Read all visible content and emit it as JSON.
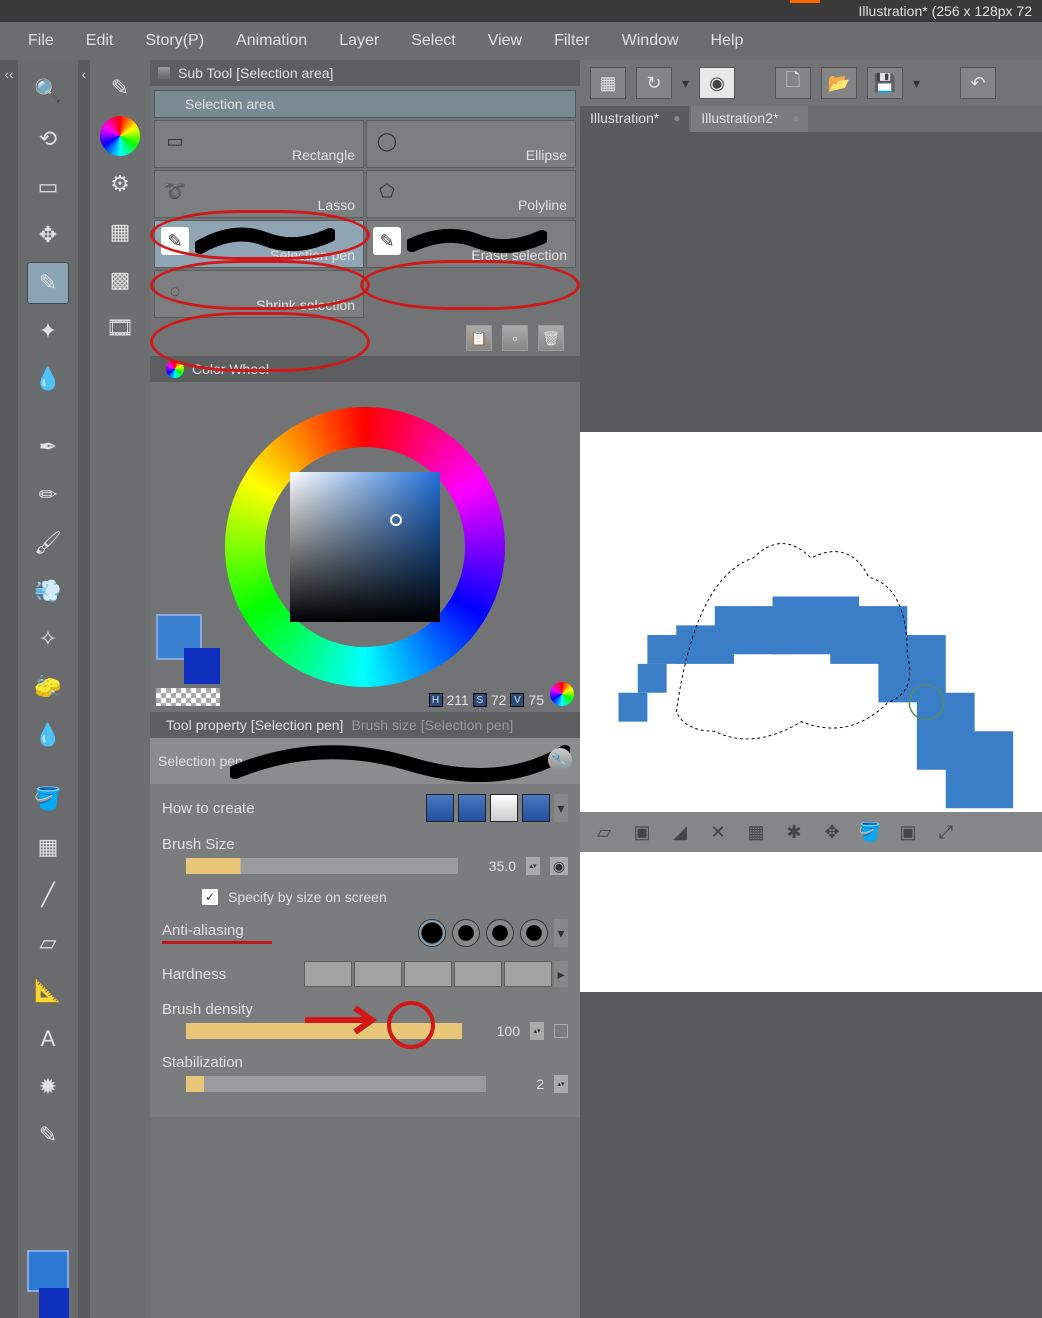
{
  "title": "Illustration* (256 x 128px 72",
  "menu": [
    "File",
    "Edit",
    "Story(P)",
    "Animation",
    "Layer",
    "Select",
    "View",
    "Filter",
    "Window",
    "Help"
  ],
  "subtool": {
    "panel_label": "Sub Tool [Selection area]",
    "group_label": "Selection area",
    "tools": [
      {
        "name": "Rectangle"
      },
      {
        "name": "Ellipse"
      },
      {
        "name": "Lasso"
      },
      {
        "name": "Polyline"
      },
      {
        "name": "Selection pen"
      },
      {
        "name": "Erase selection"
      },
      {
        "name": "Shrink selection"
      }
    ]
  },
  "colorwheel": {
    "label": "Color Wheel",
    "H": "211",
    "S": "72",
    "V": "75"
  },
  "toolprop": {
    "tab1": "Tool property [Selection pen]",
    "tab2": "Brush size [Selection pen]",
    "name": "Selection pen",
    "how_to_create": "How to create",
    "brush_size_label": "Brush Size",
    "brush_size": "35.0",
    "specify": "Specify by size on screen",
    "antialias": "Anti-aliasing",
    "hardness": "Hardness",
    "density_label": "Brush density",
    "density": "100",
    "stab_label": "Stabilization",
    "stab": "2"
  },
  "tabs": [
    {
      "label": "Illustration*",
      "active": true
    },
    {
      "label": "Illustration2*",
      "active": false
    }
  ]
}
